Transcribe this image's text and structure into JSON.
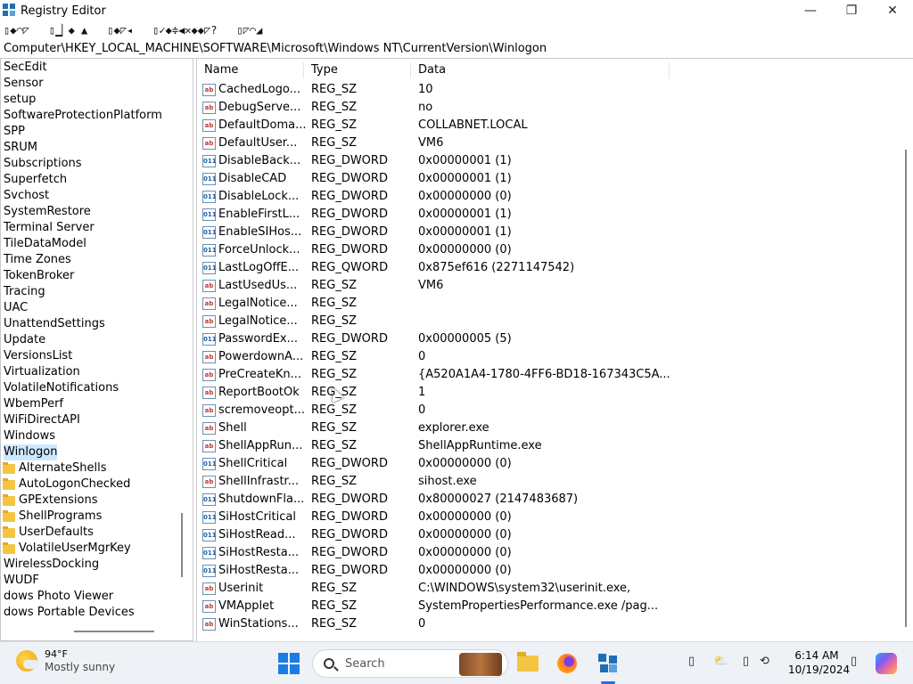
{
  "window": {
    "title": "Registry Editor",
    "controls": {
      "minimize": "—",
      "maximize": "❐",
      "close": "✕"
    }
  },
  "menu": [
    "▯◆◠◸",
    "▯▁▏◆ ▲",
    "▯◆◸◂",
    "▯✓◆≑◀✕◆◆◸?",
    "▯◸◠◢"
  ],
  "address": "Computer\\HKEY_LOCAL_MACHINE\\SOFTWARE\\Microsoft\\Windows NT\\CurrentVersion\\Winlogon",
  "tree": {
    "items": [
      {
        "label": "SecEdit",
        "folder": false
      },
      {
        "label": "Sensor",
        "folder": false
      },
      {
        "label": "setup",
        "folder": false
      },
      {
        "label": "SoftwareProtectionPlatform",
        "folder": false
      },
      {
        "label": "SPP",
        "folder": false
      },
      {
        "label": "SRUM",
        "folder": false
      },
      {
        "label": "Subscriptions",
        "folder": false
      },
      {
        "label": "Superfetch",
        "folder": false
      },
      {
        "label": "Svchost",
        "folder": false
      },
      {
        "label": "SystemRestore",
        "folder": false
      },
      {
        "label": "Terminal Server",
        "folder": false
      },
      {
        "label": "TileDataModel",
        "folder": false
      },
      {
        "label": "Time Zones",
        "folder": false
      },
      {
        "label": "TokenBroker",
        "folder": false
      },
      {
        "label": "Tracing",
        "folder": false
      },
      {
        "label": "UAC",
        "folder": false
      },
      {
        "label": "UnattendSettings",
        "folder": false
      },
      {
        "label": "Update",
        "folder": false
      },
      {
        "label": "VersionsList",
        "folder": false
      },
      {
        "label": "Virtualization",
        "folder": false
      },
      {
        "label": "VolatileNotifications",
        "folder": false
      },
      {
        "label": "WbemPerf",
        "folder": false
      },
      {
        "label": "WiFiDirectAPI",
        "folder": false
      },
      {
        "label": "Windows",
        "folder": false
      },
      {
        "label": "Winlogon",
        "folder": false,
        "selected": true
      },
      {
        "label": "AlternateShells",
        "folder": true
      },
      {
        "label": "AutoLogonChecked",
        "folder": true
      },
      {
        "label": "GPExtensions",
        "folder": true
      },
      {
        "label": "ShellPrograms",
        "folder": true
      },
      {
        "label": "UserDefaults",
        "folder": true
      },
      {
        "label": "VolatileUserMgrKey",
        "folder": true
      },
      {
        "label": "WirelessDocking",
        "folder": false
      },
      {
        "label": "WUDF",
        "folder": false
      },
      {
        "label": "dows Photo Viewer",
        "folder": false
      },
      {
        "label": "dows Portable Devices",
        "folder": false
      }
    ]
  },
  "list": {
    "headers": {
      "name": "Name",
      "type": "Type",
      "data": "Data"
    },
    "rows": [
      {
        "name": "CachedLogo...",
        "type": "REG_SZ",
        "data": "10"
      },
      {
        "name": "DebugServe...",
        "type": "REG_SZ",
        "data": "no"
      },
      {
        "name": "DefaultDoma...",
        "type": "REG_SZ",
        "data": "COLLABNET.LOCAL"
      },
      {
        "name": "DefaultUser...",
        "type": "REG_SZ",
        "data": "VM6"
      },
      {
        "name": "DisableBack...",
        "type": "REG_DWORD",
        "data": "0x00000001 (1)"
      },
      {
        "name": "DisableCAD",
        "type": "REG_DWORD",
        "data": "0x00000001 (1)"
      },
      {
        "name": "DisableLock...",
        "type": "REG_DWORD",
        "data": "0x00000000 (0)"
      },
      {
        "name": "EnableFirstL...",
        "type": "REG_DWORD",
        "data": "0x00000001 (1)"
      },
      {
        "name": "EnableSIHos...",
        "type": "REG_DWORD",
        "data": "0x00000001 (1)"
      },
      {
        "name": "ForceUnlock...",
        "type": "REG_DWORD",
        "data": "0x00000000 (0)"
      },
      {
        "name": "LastLogOffE...",
        "type": "REG_QWORD",
        "data": "0x875ef616 (2271147542)"
      },
      {
        "name": "LastUsedUs...",
        "type": "REG_SZ",
        "data": "VM6"
      },
      {
        "name": "LegalNotice...",
        "type": "REG_SZ",
        "data": ""
      },
      {
        "name": "LegalNotice...",
        "type": "REG_SZ",
        "data": ""
      },
      {
        "name": "PasswordEx...",
        "type": "REG_DWORD",
        "data": "0x00000005 (5)"
      },
      {
        "name": "PowerdownA...",
        "type": "REG_SZ",
        "data": "0"
      },
      {
        "name": "PreCreateKn...",
        "type": "REG_SZ",
        "data": "{A520A1A4-1780-4FF6-BD18-167343C5A..."
      },
      {
        "name": "ReportBootOk",
        "type": "REG_SZ",
        "data": "1"
      },
      {
        "name": "scremoveopt...",
        "type": "REG_SZ",
        "data": "0"
      },
      {
        "name": "Shell",
        "type": "REG_SZ",
        "data": "explorer.exe"
      },
      {
        "name": "ShellAppRun...",
        "type": "REG_SZ",
        "data": "ShellAppRuntime.exe"
      },
      {
        "name": "ShellCritical",
        "type": "REG_DWORD",
        "data": "0x00000000 (0)"
      },
      {
        "name": "ShellInfrastr...",
        "type": "REG_SZ",
        "data": "sihost.exe"
      },
      {
        "name": "ShutdownFla...",
        "type": "REG_DWORD",
        "data": "0x80000027 (2147483687)"
      },
      {
        "name": "SiHostCritical",
        "type": "REG_DWORD",
        "data": "0x00000000 (0)"
      },
      {
        "name": "SiHostRead...",
        "type": "REG_DWORD",
        "data": "0x00000000 (0)"
      },
      {
        "name": "SiHostResta...",
        "type": "REG_DWORD",
        "data": "0x00000000 (0)"
      },
      {
        "name": "SiHostResta...",
        "type": "REG_DWORD",
        "data": "0x00000000 (0)"
      },
      {
        "name": "Userinit",
        "type": "REG_SZ",
        "data": "C:\\WINDOWS\\system32\\userinit.exe,"
      },
      {
        "name": "VMApplet",
        "type": "REG_SZ",
        "data": "SystemPropertiesPerformance.exe /pag..."
      },
      {
        "name": "WinStations...",
        "type": "REG_SZ",
        "data": "0"
      }
    ]
  },
  "taskbar": {
    "weather": {
      "temp": "94°F",
      "condition": "Mostly sunny"
    },
    "search_placeholder": "Search",
    "time": "6:14 AM",
    "date": "10/19/2024",
    "tray_icons": [
      "▯",
      "⛅",
      "▯",
      "⟲",
      "▯"
    ]
  }
}
